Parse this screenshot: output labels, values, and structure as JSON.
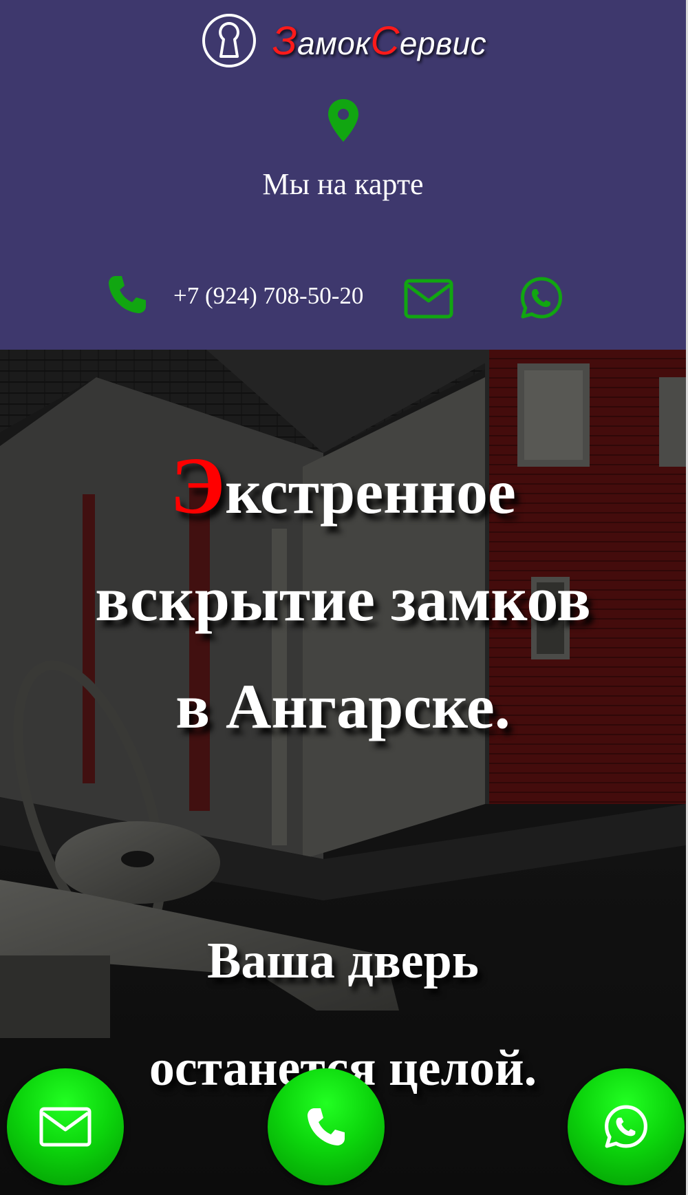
{
  "header": {
    "logo_text_parts": [
      {
        "text": "З",
        "accent": true
      },
      {
        "text": "амок",
        "accent": false
      },
      {
        "text": "С",
        "accent": true
      },
      {
        "text": "ервис",
        "accent": false
      }
    ],
    "map_link": "Мы на карте",
    "phone": "+7 (924) 708-50-20"
  },
  "hero": {
    "title_first_letter": "Э",
    "title_line1_rest": "кстренное",
    "title_line2": "вскрытие замков",
    "title_line3": "в Ангарске.",
    "subtitle_line1": "Ваша дверь",
    "subtitle_line2": "останется целой."
  },
  "icons": {
    "logo": "keyhole-icon",
    "map": "map-pin-icon",
    "phone": "phone-icon",
    "mail": "mail-icon",
    "whatsapp": "whatsapp-icon"
  },
  "colors": {
    "header_bg": "#3e386d",
    "accent_red": "#ff1a1a",
    "icon_green": "#11a611",
    "button_green": "#0cd50c"
  },
  "floating_buttons": [
    {
      "name": "mail-floating-button",
      "icon": "mail-icon"
    },
    {
      "name": "call-floating-button",
      "icon": "phone-icon"
    },
    {
      "name": "whatsapp-floating-button",
      "icon": "whatsapp-icon"
    }
  ]
}
